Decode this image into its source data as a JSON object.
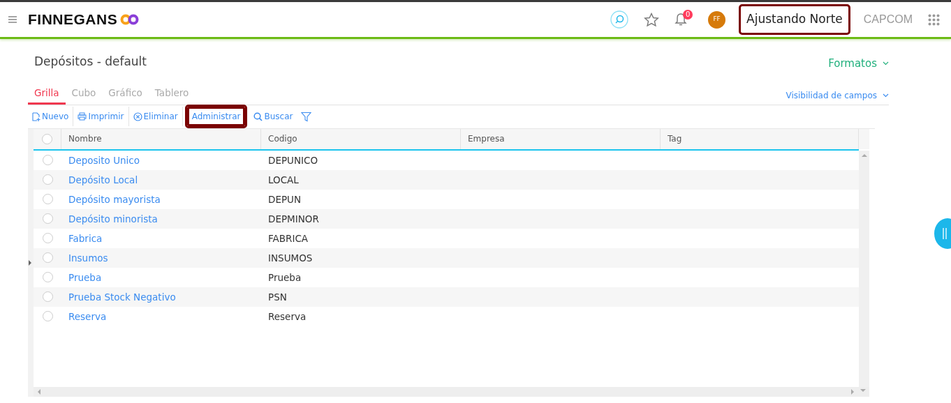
{
  "header": {
    "logo": "FINNEGANS",
    "notifications": "0",
    "avatar": "FF",
    "company": "Ajustando Norte",
    "company_highlighted": true,
    "org": "CAPCOM"
  },
  "page": {
    "title": "Depósitos - default",
    "formats": "Formatos"
  },
  "tabs": [
    {
      "label": "Grilla",
      "selected": true
    },
    {
      "label": "Cubo",
      "selected": false
    },
    {
      "label": "Gráfico",
      "selected": false
    },
    {
      "label": "Tablero",
      "selected": false
    }
  ],
  "field_visibility": "Visibilidad de campos",
  "toolbar": [
    {
      "label": "Nuevo",
      "kind": "new",
      "highlighted": false
    },
    {
      "label": "Imprimir",
      "kind": "print",
      "highlighted": false
    },
    {
      "label": "Eliminar",
      "kind": "delete",
      "highlighted": false
    },
    {
      "label": "Administrar",
      "kind": "plain",
      "highlighted": true
    },
    {
      "label": "Buscar",
      "kind": "search",
      "highlighted": false
    },
    {
      "kind": "filter"
    }
  ],
  "table": {
    "all_selected": false,
    "columns": [
      "Nombre",
      "Codigo",
      "Empresa",
      "Tag"
    ],
    "rows": [
      {
        "nombre": "Deposito Unico",
        "codigo": "DEPUNICO",
        "selected": false
      },
      {
        "nombre": "Depósito Local",
        "codigo": "LOCAL",
        "selected": false
      },
      {
        "nombre": "Depósito mayorista",
        "codigo": "DEPUN",
        "selected": false
      },
      {
        "nombre": "Depósito minorista",
        "codigo": "DEPMINOR",
        "selected": false
      },
      {
        "nombre": "Fabrica",
        "codigo": "FABRICA",
        "selected": false
      },
      {
        "nombre": "Insumos",
        "codigo": "INSUMOS",
        "selected": false
      },
      {
        "nombre": "Prueba",
        "codigo": "Prueba",
        "selected": false
      },
      {
        "nombre": "Prueba Stock Negativo",
        "codigo": "PSN",
        "selected": false
      },
      {
        "nombre": "Reserva",
        "codigo": "Reserva",
        "selected": false
      }
    ]
  }
}
